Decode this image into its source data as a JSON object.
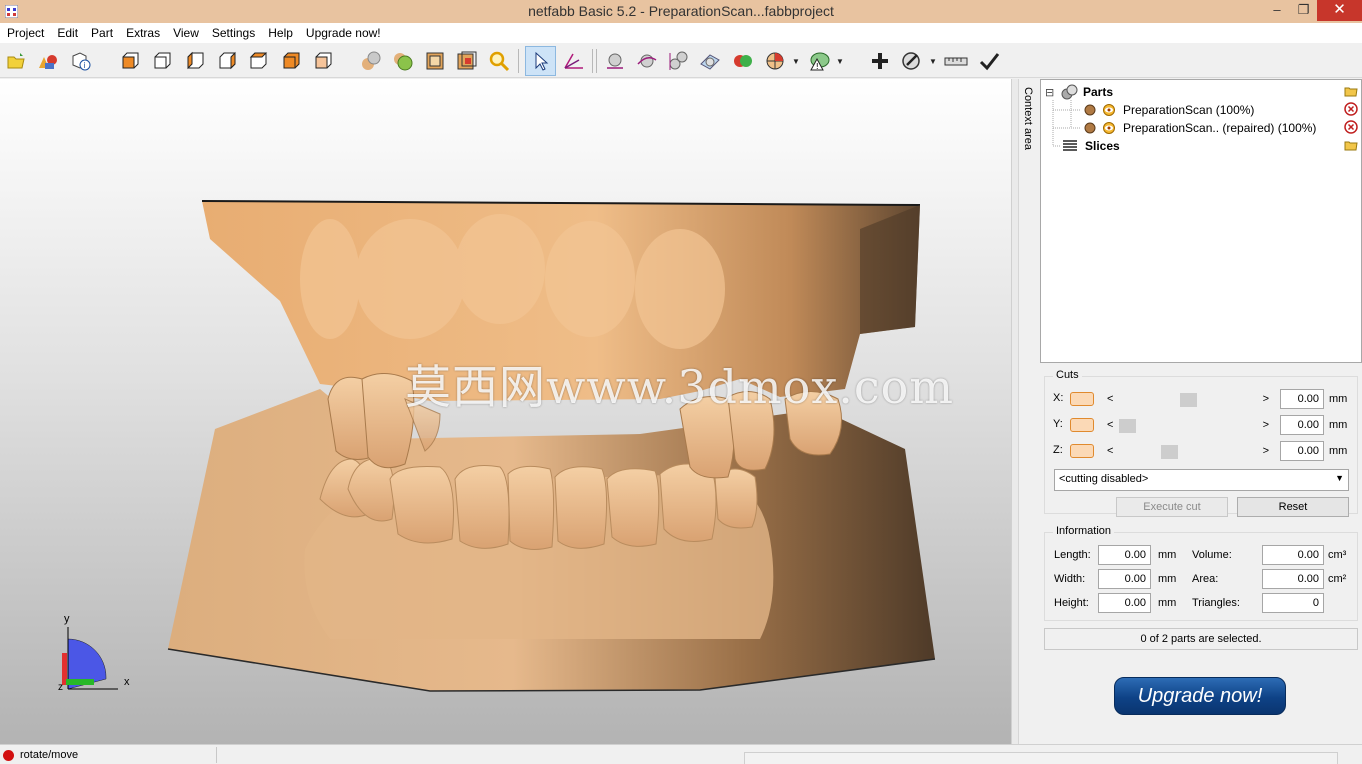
{
  "window": {
    "title": "netfabb Basic 5.2 - PreparationScan...fabbproject",
    "minimize_glyph": "–",
    "maximize_glyph": "❐",
    "close_glyph": "✕"
  },
  "menu": [
    "Project",
    "Edit",
    "Part",
    "Extras",
    "View",
    "Settings",
    "Help",
    "Upgrade now!"
  ],
  "toolbar": {
    "icons": [
      "open-project-icon",
      "add-part-icon",
      "part-info-icon",
      "view-front-icon",
      "view-back-icon",
      "view-left-icon",
      "view-right-icon",
      "view-top-icon",
      "view-bottom-icon",
      "view-perspective-icon",
      "shading-icon",
      "wireframe-icon",
      "clipping-icon",
      "zoom-icon",
      "select-icon",
      "measure-axis-icon",
      "sphere-icon",
      "translate-icon",
      "move-parts-icon",
      "rotate-view-icon",
      "color-icon",
      "pie-menu-icon",
      "warning-icon",
      "repair-add-icon",
      "repair-icon",
      "ruler-icon",
      "apply-checkmark-icon"
    ]
  },
  "viewport": {
    "watermark": "莫西网www.3dmox.com",
    "axis_labels": {
      "x": "x",
      "y": "y",
      "z": "z"
    },
    "colors": {
      "model_light": "#e9b078",
      "model_mid": "#d9a472",
      "model_dark": "#5c4630"
    }
  },
  "context_tab": {
    "label": "Context area"
  },
  "tree": {
    "root_toggle": "⊟",
    "parts_label": "Parts",
    "parts": [
      {
        "name": "PreparationScan (100%)"
      },
      {
        "name": "PreparationScan.. (repaired) (100%)"
      }
    ],
    "slices_label": "Slices"
  },
  "cuts": {
    "title": "Cuts",
    "rows": [
      {
        "axis": "X:",
        "value": "0.00",
        "unit": "mm",
        "thumb_fraction": 0.5
      },
      {
        "axis": "Y:",
        "value": "0.00",
        "unit": "mm",
        "thumb_fraction": 0.0
      },
      {
        "axis": "Z:",
        "value": "0.00",
        "unit": "mm",
        "thumb_fraction": 0.35
      }
    ],
    "left_arrow": "<",
    "right_arrow": ">",
    "mode_select": "<cutting disabled>",
    "execute_label": "Execute cut",
    "reset_label": "Reset"
  },
  "information": {
    "title": "Information",
    "length_label": "Length:",
    "length_value": "0.00",
    "length_unit": "mm",
    "width_label": "Width:",
    "width_value": "0.00",
    "width_unit": "mm",
    "height_label": "Height:",
    "height_value": "0.00",
    "height_unit": "mm",
    "volume_label": "Volume:",
    "volume_value": "0.00",
    "volume_unit": "cm³",
    "area_label": "Area:",
    "area_value": "0.00",
    "area_unit": "cm²",
    "triangles_label": "Triangles:",
    "triangles_value": "0"
  },
  "selection_status": "0 of 2 parts are selected.",
  "upgrade_button": "Upgrade now!",
  "statusbar": {
    "mode": "rotate/move"
  }
}
